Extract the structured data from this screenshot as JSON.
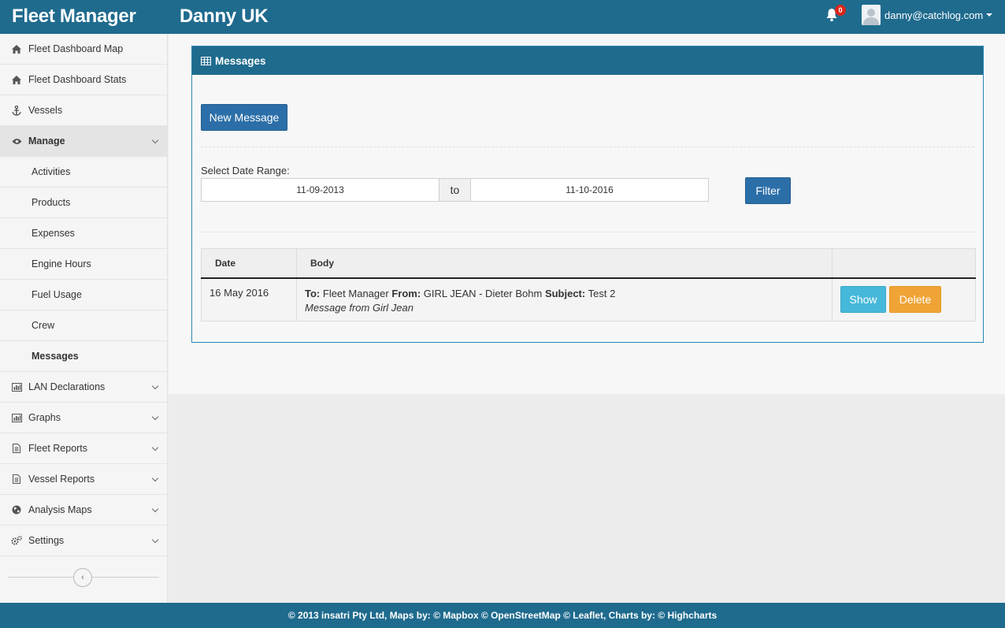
{
  "header": {
    "brand": "Fleet Manager",
    "org": "Danny UK",
    "notifications": "0",
    "user_email": "danny@catchlog.com"
  },
  "sidebar": {
    "items": [
      {
        "label": "Fleet Dashboard Map",
        "icon": "home-icon"
      },
      {
        "label": "Fleet Dashboard Stats",
        "icon": "home-icon"
      },
      {
        "label": "Vessels",
        "icon": "anchor-icon"
      },
      {
        "label": "Manage",
        "icon": "eye-icon"
      },
      {
        "label": "Activities"
      },
      {
        "label": "Products"
      },
      {
        "label": "Expenses"
      },
      {
        "label": "Engine Hours"
      },
      {
        "label": "Fuel Usage"
      },
      {
        "label": "Crew"
      },
      {
        "label": "Messages"
      },
      {
        "label": "LAN Declarations",
        "icon": "bar-chart-icon"
      },
      {
        "label": "Graphs",
        "icon": "bar-chart-icon"
      },
      {
        "label": "Fleet Reports",
        "icon": "document-icon"
      },
      {
        "label": "Vessel Reports",
        "icon": "document-icon"
      },
      {
        "label": "Analysis Maps",
        "icon": "globe-icon"
      },
      {
        "label": "Settings",
        "icon": "gears-icon"
      }
    ]
  },
  "panel": {
    "title": "Messages",
    "new_message_label": "New Message",
    "date_range_label": "Select Date Range:",
    "date_from": "11-09-2013",
    "date_to_label": "to",
    "date_to": "11-10-2016",
    "filter_label": "Filter",
    "table": {
      "headers": [
        "Date",
        "Body",
        ""
      ],
      "rows": [
        {
          "date": "16 May 2016",
          "to_label": "To:",
          "to": "Fleet Manager",
          "from_label": "From:",
          "from": "GIRL JEAN - Dieter Bohm",
          "subject_label": "Subject:",
          "subject": "Test 2",
          "body": "Message from Girl Jean",
          "show_label": "Show",
          "delete_label": "Delete"
        }
      ]
    }
  },
  "footer": {
    "text": "© 2013 insatri Pty Ltd, Maps by: © Mapbox © OpenStreetMap © Leaflet, Charts by: © Highcharts"
  },
  "colors": {
    "header": "#1f6b8e",
    "primary": "#2c6fa8",
    "info": "#46b8da",
    "warning": "#efa435",
    "badge": "#d9261c"
  }
}
